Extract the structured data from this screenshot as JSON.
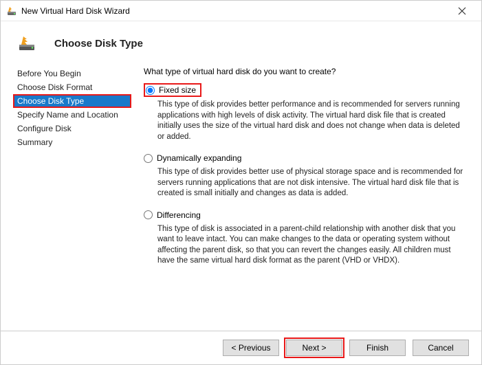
{
  "window": {
    "title": "New Virtual Hard Disk Wizard"
  },
  "header": {
    "heading": "Choose Disk Type"
  },
  "sidebar": {
    "steps": {
      "0": "Before You Begin",
      "1": "Choose Disk Format",
      "2": "Choose Disk Type",
      "3": "Specify Name and Location",
      "4": "Configure Disk",
      "5": "Summary"
    }
  },
  "main": {
    "prompt": "What type of virtual hard disk do you want to create?",
    "options": {
      "fixed": {
        "label": "Fixed size",
        "desc": "This type of disk provides better performance and is recommended for servers running applications with high levels of disk activity. The virtual hard disk file that is created initially uses the size of the virtual hard disk and does not change when data is deleted or added."
      },
      "dynamic": {
        "label": "Dynamically expanding",
        "desc": "This type of disk provides better use of physical storage space and is recommended for servers running applications that are not disk intensive. The virtual hard disk file that is created is small initially and changes as data is added."
      },
      "diff": {
        "label": "Differencing",
        "desc": "This type of disk is associated in a parent-child relationship with another disk that you want to leave intact. You can make changes to the data or operating system without affecting the parent disk, so that you can revert the changes easily. All children must have the same virtual hard disk format as the parent (VHD or VHDX)."
      }
    }
  },
  "footer": {
    "previous": "< Previous",
    "next": "Next >",
    "finish": "Finish",
    "cancel": "Cancel"
  }
}
